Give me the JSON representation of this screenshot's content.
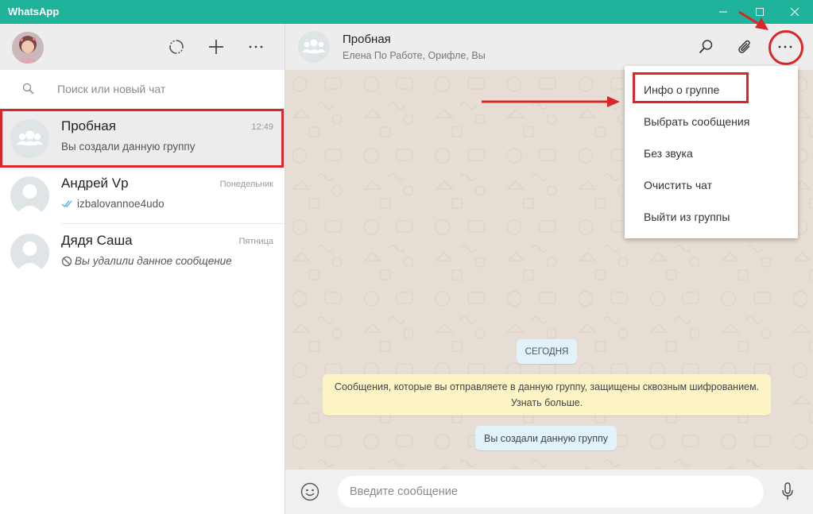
{
  "window": {
    "title": "WhatsApp"
  },
  "sidebar": {
    "search_placeholder": "Поиск или новый чат",
    "chats": [
      {
        "name": "Пробная",
        "time": "12:49",
        "message": "Вы создали данную группу"
      },
      {
        "name": "Андрей Vp",
        "time": "Понедельник",
        "message": "izbalovannoe4udo"
      },
      {
        "name": "Дядя Саша",
        "time": "Пятница",
        "message": "Вы удалили данное сообщение"
      }
    ]
  },
  "conversation": {
    "title": "Пробная",
    "members": "Елена По Работе, Орифле, Вы",
    "day_label": "СЕГОДНЯ",
    "encryption_notice_line1": "Сообщения, которые вы отправляете в данную группу, защищены сквозным шифрованием.",
    "encryption_notice_line2": "Узнать больше.",
    "system_message": "Вы создали данную группу",
    "input_placeholder": "Введите сообщение"
  },
  "menu": {
    "items": [
      "Инфо о группе",
      "Выбрать сообщения",
      "Без звука",
      "Очистить чат",
      "Выйти из группы"
    ]
  },
  "colors": {
    "titlebar": "#1fb39c",
    "annotation": "#d9262a",
    "chat_background": "#e6ddd4",
    "notice": "#fcf4c4",
    "system_bubble": "#e1f2fb",
    "read_ticks": "#4fb6ec"
  }
}
